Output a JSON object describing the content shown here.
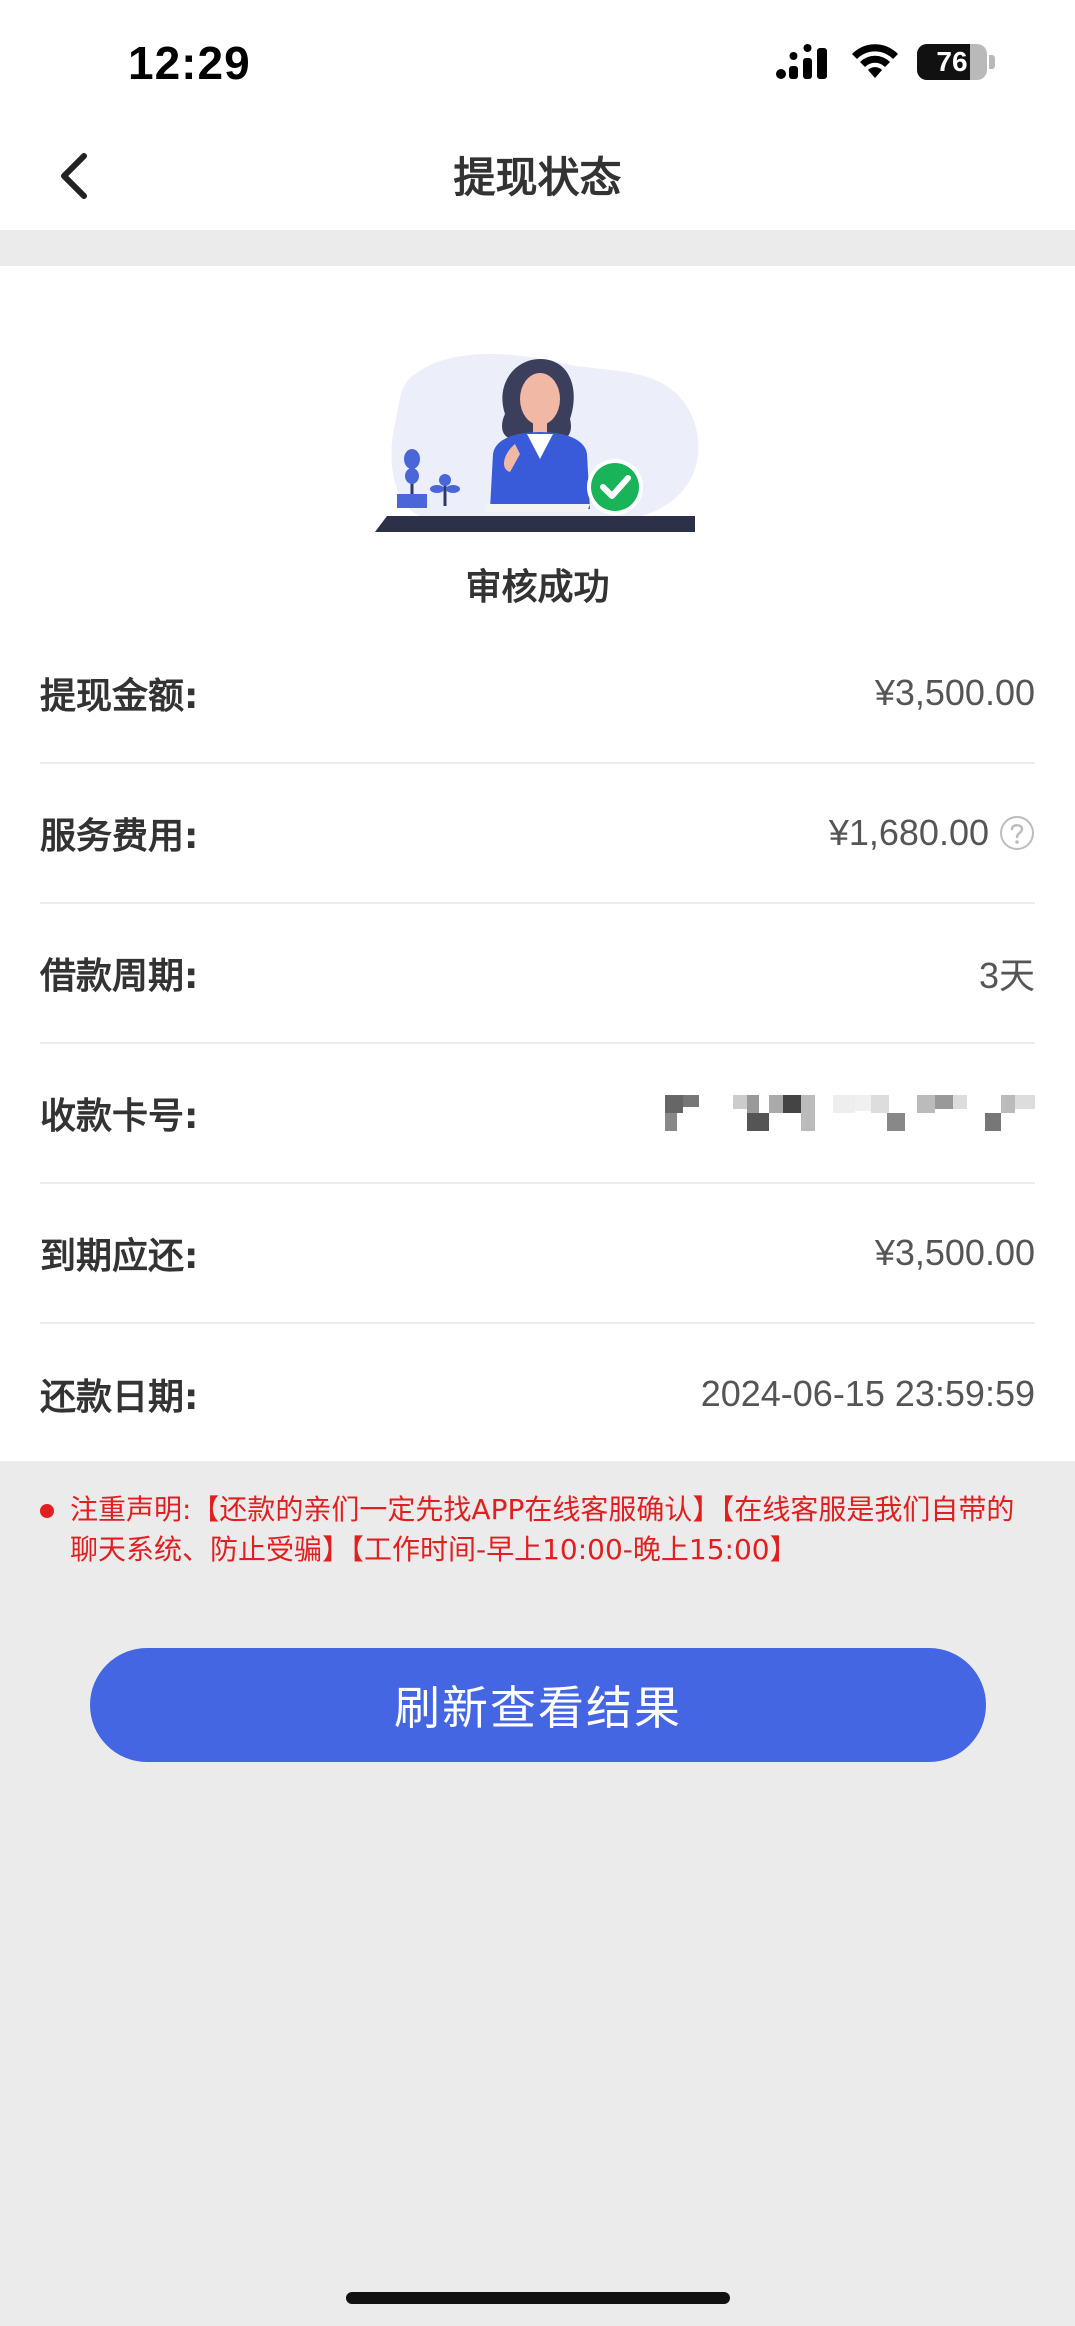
{
  "status_bar": {
    "time": "12:29",
    "battery": "76",
    "battery_level": 0.76
  },
  "nav": {
    "title": "提现状态",
    "back_icon": "chevron-left-icon"
  },
  "result": {
    "text": "审核成功",
    "status_icon": "check-circle-icon",
    "status_color": "#19b35a"
  },
  "details": [
    {
      "label": "提现金额:",
      "value": "¥3,500.00"
    },
    {
      "label": "服务费用:",
      "value": "¥1,680.00"
    },
    {
      "label": "借款周期:",
      "value": "3天"
    },
    {
      "label": "收款卡号:",
      "value": ""
    },
    {
      "label": "到期应还:",
      "value": "¥3,500.00"
    },
    {
      "label": "还款日期:",
      "value": "2024-06-15 23:59:59"
    }
  ],
  "notice": "注重声明:【还款的亲们一定先找APP在线客服确认】【在线客服是我们自带的聊天系统、防止受骗】【工作时间-早上10:00-晚上15:00】",
  "refresh_button": {
    "label": "刷新查看结果"
  },
  "colors": {
    "accent": "#4466e3",
    "warning": "#e02020",
    "success": "#19b35a"
  }
}
